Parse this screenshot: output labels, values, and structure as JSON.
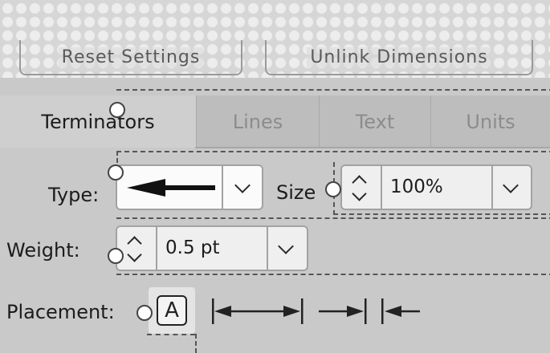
{
  "top_buttons": {
    "reset_label": "Reset Settings",
    "unlink_label": "Unlink Dimensions"
  },
  "tabs": [
    {
      "label": "Terminators",
      "active": true
    },
    {
      "label": "Lines",
      "active": false
    },
    {
      "label": "Text",
      "active": false
    },
    {
      "label": "Units",
      "active": false
    }
  ],
  "type_row": {
    "label": "Type:",
    "selected_icon": "arrow-left-icon"
  },
  "size_row": {
    "label": "Size",
    "value": "100%"
  },
  "weight_row": {
    "label": "Weight:",
    "value": "0.5 pt"
  },
  "placement_row": {
    "label": "Placement:",
    "auto_letter": "A",
    "options": [
      "auto-icon",
      "outside-arrows-icon",
      "inside-arrows-icon"
    ]
  },
  "colors": {
    "panel": "#c9c9c9",
    "tab_inactive": "#bdbdbd",
    "field": "#efefef",
    "inactive_text": "#8c8c8c"
  }
}
